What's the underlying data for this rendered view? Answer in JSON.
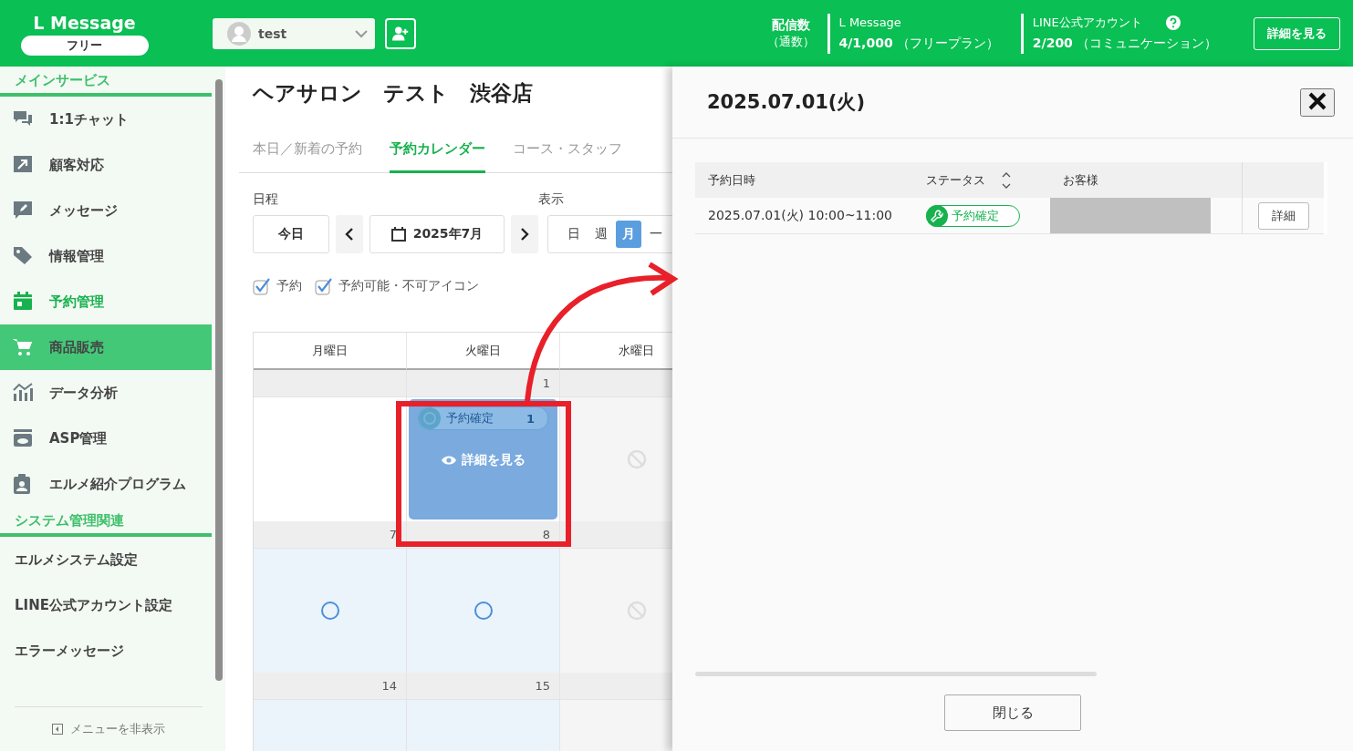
{
  "header": {
    "logo": "L Message",
    "plan": "フリー",
    "account": "test",
    "stats_label": {
      "title": "配信数",
      "sub": "（通数）"
    },
    "stats": [
      {
        "title": "L Message",
        "count": "4/1,000",
        "plan": "（フリープラン）",
        "help": false
      },
      {
        "title": "LINE公式アカウント",
        "count": "2/200",
        "plan": "（コミュニケーション）",
        "help": true
      }
    ],
    "details_button": "詳細を見る"
  },
  "sidebar": {
    "sections": [
      {
        "title": "メインサービス",
        "items": [
          {
            "label": "1:1チャット",
            "selected": false,
            "highlighted": false
          },
          {
            "label": "顧客対応",
            "selected": false,
            "highlighted": false
          },
          {
            "label": "メッセージ",
            "selected": false,
            "highlighted": false
          },
          {
            "label": "情報管理",
            "selected": false,
            "highlighted": false
          },
          {
            "label": "予約管理",
            "selected": true,
            "highlighted": false
          },
          {
            "label": "商品販売",
            "selected": false,
            "highlighted": true
          },
          {
            "label": "データ分析",
            "selected": false,
            "highlighted": false
          },
          {
            "label": "ASP管理",
            "selected": false,
            "highlighted": false
          },
          {
            "label": "エルメ紹介プログラム",
            "selected": false,
            "highlighted": false
          }
        ]
      },
      {
        "title": "システム管理関連",
        "items": [
          {
            "label": "エルメシステム設定",
            "selected": false,
            "highlighted": false
          },
          {
            "label": "LINE公式アカウント設定",
            "selected": false,
            "highlighted": false
          },
          {
            "label": "エラーメッセージ",
            "selected": false,
            "highlighted": false
          }
        ]
      }
    ],
    "hide_menu": "メニューを非表示"
  },
  "main": {
    "title": "ヘアサロン　テスト　渋谷店",
    "tabs": [
      {
        "label": "本日／新着の予約",
        "selected": false
      },
      {
        "label": "予約カレンダー",
        "selected": true
      },
      {
        "label": "コース・スタッフ",
        "selected": false
      }
    ],
    "schedule_label": "日程",
    "today_button": "今日",
    "month": "2025年7月",
    "view_label": "表示",
    "view_options": [
      {
        "label": "日",
        "selected": false
      },
      {
        "label": "週",
        "selected": false
      },
      {
        "label": "月",
        "selected": true
      },
      {
        "label": "一",
        "selected": false
      }
    ],
    "filters": [
      {
        "label": "予約",
        "checked": true
      },
      {
        "label": "予約可能・不可アイコン",
        "checked": true
      }
    ],
    "calendar": {
      "weekdays": [
        "月曜日",
        "火曜日",
        "水曜日"
      ],
      "weeks": [
        {
          "days": [
            {
              "kind": "blank"
            },
            {
              "date": "1",
              "kind": "event",
              "status": "予約確定",
              "count": "1",
              "action": "詳細を見る"
            },
            {
              "kind": "closed"
            }
          ]
        },
        {
          "days": [
            {
              "date": "7",
              "kind": "available"
            },
            {
              "date": "8",
              "kind": "available"
            },
            {
              "kind": "closed"
            }
          ]
        },
        {
          "days": [
            {
              "date": "14",
              "kind": "shaded"
            },
            {
              "date": "15",
              "kind": "shaded"
            },
            {
              "kind": "grey"
            }
          ]
        }
      ]
    }
  },
  "panel": {
    "title": "2025.07.01(火)",
    "columns": [
      "予約日時",
      "ステータス",
      "お客様"
    ],
    "rows": [
      {
        "datetime": "2025.07.01(火) 10:00~11:00",
        "status": "予約確定",
        "button": "詳細"
      }
    ],
    "close_button": "閉じる"
  }
}
